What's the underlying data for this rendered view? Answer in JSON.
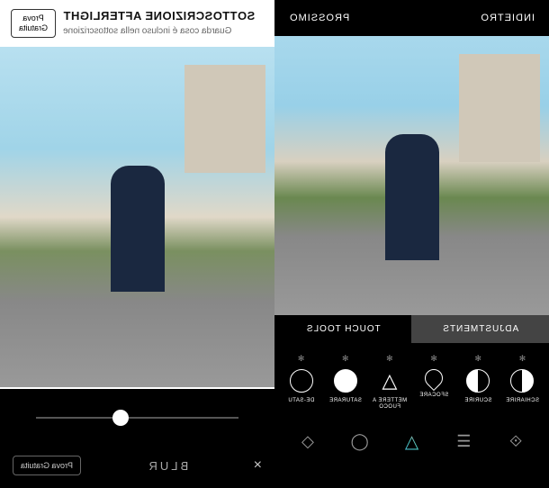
{
  "left": {
    "title": "SOTTOSCRIZIONE AFTERLIGHT",
    "subtitle": "Guarda cosa é incluso nella sottoscrizione",
    "trial_button": "Prova\nGratuita",
    "bottom": {
      "close": "×",
      "label": "BLUR",
      "trial": "Prova Gratuita"
    }
  },
  "right": {
    "header": {
      "back": "INDIETRO",
      "next": "PROSSIMO"
    },
    "tabs": {
      "adjustments": "ADJUSTMENTS",
      "touch_tools": "TOUCH TOOLS"
    },
    "tools": [
      {
        "label": "SCHIARIRE"
      },
      {
        "label": "SCURIRE"
      },
      {
        "label": "SFOCARE"
      },
      {
        "label": "METTERE A FUOCO"
      },
      {
        "label": "SATURARE"
      },
      {
        "label": "DE-SATU"
      }
    ]
  }
}
